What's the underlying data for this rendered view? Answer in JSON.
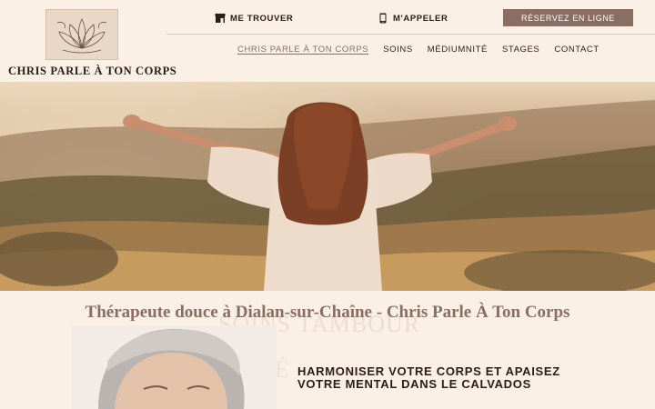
{
  "header": {
    "brand": "CHRIS PARLE À TON CORPS",
    "find_us": "ME TROUVER",
    "call_me": "M'APPELER",
    "cta": "RÉSERVEZ EN LIGNE"
  },
  "nav": {
    "items": [
      "CHRIS PARLE À TON CORPS",
      "SOINS",
      "MÉDIUMNITÉ",
      "STAGES",
      "CONTACT"
    ],
    "active": "CHRIS PARLE À TON CORPS"
  },
  "main": {
    "subtitle": "Thérapeute douce à Dialan-sur-Chaîne - Chris Parle À Ton Corps",
    "ghost_text": "SOINS TAMBOUR",
    "ghost_text_2": "É",
    "headline": "HARMONISER VOTRE CORPS ET APAISEZ VOTRE MENTAL DANS LE CALVADOS"
  },
  "colors": {
    "background": "#fbf0e6",
    "accent": "#8a6e62",
    "text": "#2a1d16"
  },
  "icons": [
    "lotus-logo-icon",
    "store-icon",
    "phone-icon"
  ]
}
